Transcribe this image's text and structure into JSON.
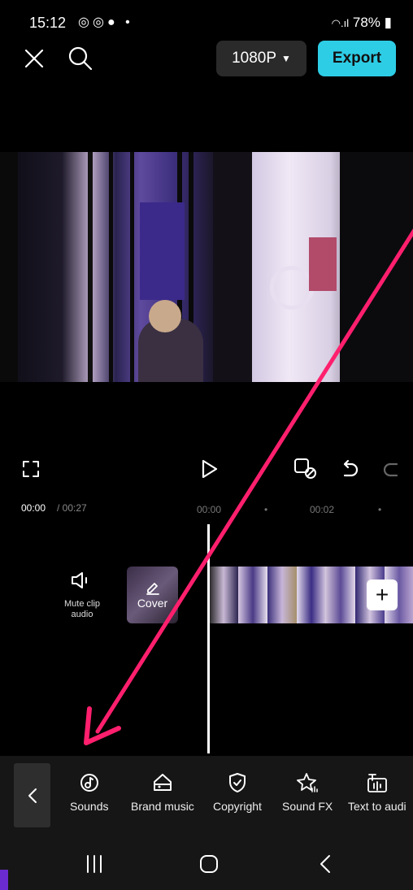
{
  "status_bar": {
    "time": "15:12",
    "app_icons": [
      "instagram-icon",
      "instagram-icon",
      "facebook-icon"
    ],
    "dot": "•",
    "battery": "78%"
  },
  "top_bar": {
    "close_icon": "close-icon",
    "search_icon": "search-icon",
    "resolution": "1080P",
    "export_label": "Export"
  },
  "controls": {
    "fullscreen_icon": "fullscreen-icon",
    "play_icon": "play-icon",
    "keyframe_icon": "keyframe-icon",
    "undo_icon": "undo-icon",
    "redo_icon": "redo-icon"
  },
  "timeline": {
    "current_time": "00:00",
    "total_time": " / 00:27",
    "ticks": [
      "00:00",
      "•",
      "00:02",
      "•"
    ],
    "mute_label": "Mute clip audio",
    "cover_label": "Cover"
  },
  "toolbar": {
    "tools": [
      {
        "label": "Sounds",
        "icon": "sounds-icon"
      },
      {
        "label": "Brand music",
        "icon": "brand-music-icon"
      },
      {
        "label": "Copyright",
        "icon": "copyright-shield-icon"
      },
      {
        "label": "Sound FX",
        "icon": "sound-fx-icon"
      },
      {
        "label": "Text to audi",
        "icon": "text-to-audio-icon"
      }
    ]
  },
  "colors": {
    "accent": "#2ecde6",
    "annotation_arrow": "#ff1f6d",
    "background": "#000000",
    "toolbar_bg": "#161616"
  }
}
